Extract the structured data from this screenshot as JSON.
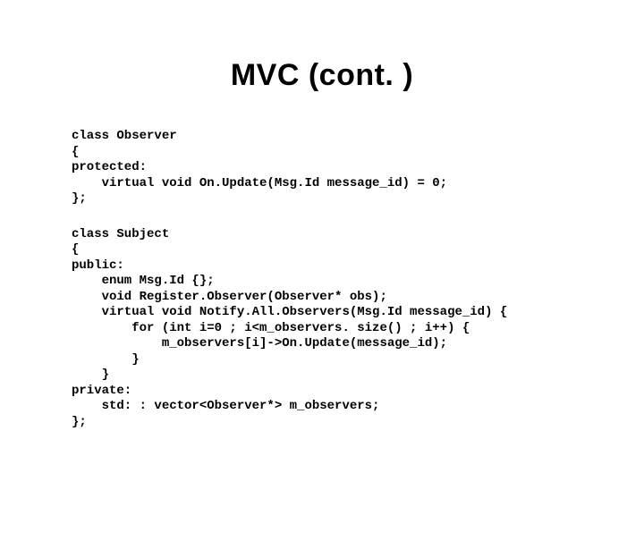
{
  "title": "MVC (cont. )",
  "code1": "class Observer\n{\nprotected:\n    virtual void On.Update(Msg.Id message_id) = 0;\n};",
  "code2": "class Subject\n{\npublic:\n    enum Msg.Id {};\n    void Register.Observer(Observer* obs);\n    virtual void Notify.All.Observers(Msg.Id message_id) {\n        for (int i=0 ; i<m_observers. size() ; i++) {\n            m_observers[i]->On.Update(message_id);\n        }\n    }\nprivate:\n    std: : vector<Observer*> m_observers;\n};"
}
